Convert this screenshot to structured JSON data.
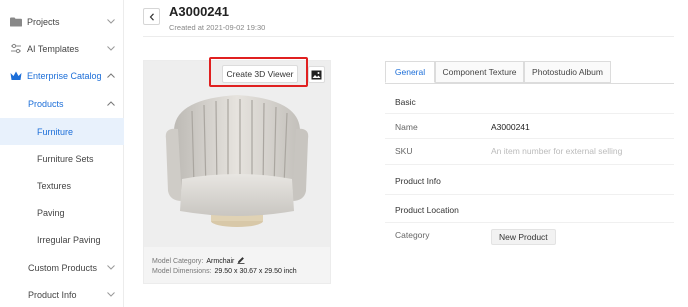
{
  "sidebar": {
    "items": [
      {
        "label": "Projects",
        "icon": "folder-icon"
      },
      {
        "label": "AI Templates",
        "icon": "sliders-icon"
      },
      {
        "label": "Enterprise Catalog",
        "icon": "crown-icon"
      },
      {
        "label": "Products"
      },
      {
        "label": "Furniture"
      },
      {
        "label": "Furniture Sets"
      },
      {
        "label": "Textures"
      },
      {
        "label": "Paving"
      },
      {
        "label": "Irregular Paving"
      },
      {
        "label": "Custom Products"
      },
      {
        "label": "Product Info"
      }
    ],
    "accent_color": "#1c6ed8",
    "selected_bg": "#e8f1fc"
  },
  "header": {
    "title": "A3000241",
    "created": "Created at 2021-09-02 19:30"
  },
  "preview": {
    "create_viewer_label": "Create 3D Viewer",
    "image_button_icon": "image-icon",
    "model_category_label": "Model Category:",
    "model_category_value": "Armchair",
    "model_dimensions_label": "Model Dimensions:",
    "model_dimensions_value": "29.50 x 30.67 x 29.50 inch"
  },
  "tabs": [
    {
      "label": "General",
      "active": true
    },
    {
      "label": "Component Texture",
      "active": false
    },
    {
      "label": "Photostudio Album",
      "active": false
    }
  ],
  "details": {
    "basic_heading": "Basic",
    "name_label": "Name",
    "name_value": "A3000241",
    "sku_label": "SKU",
    "sku_placeholder": "An item number for external selling",
    "product_info_heading": "Product Info",
    "product_location_heading": "Product Location",
    "category_label": "Category",
    "category_button": "New Product"
  }
}
